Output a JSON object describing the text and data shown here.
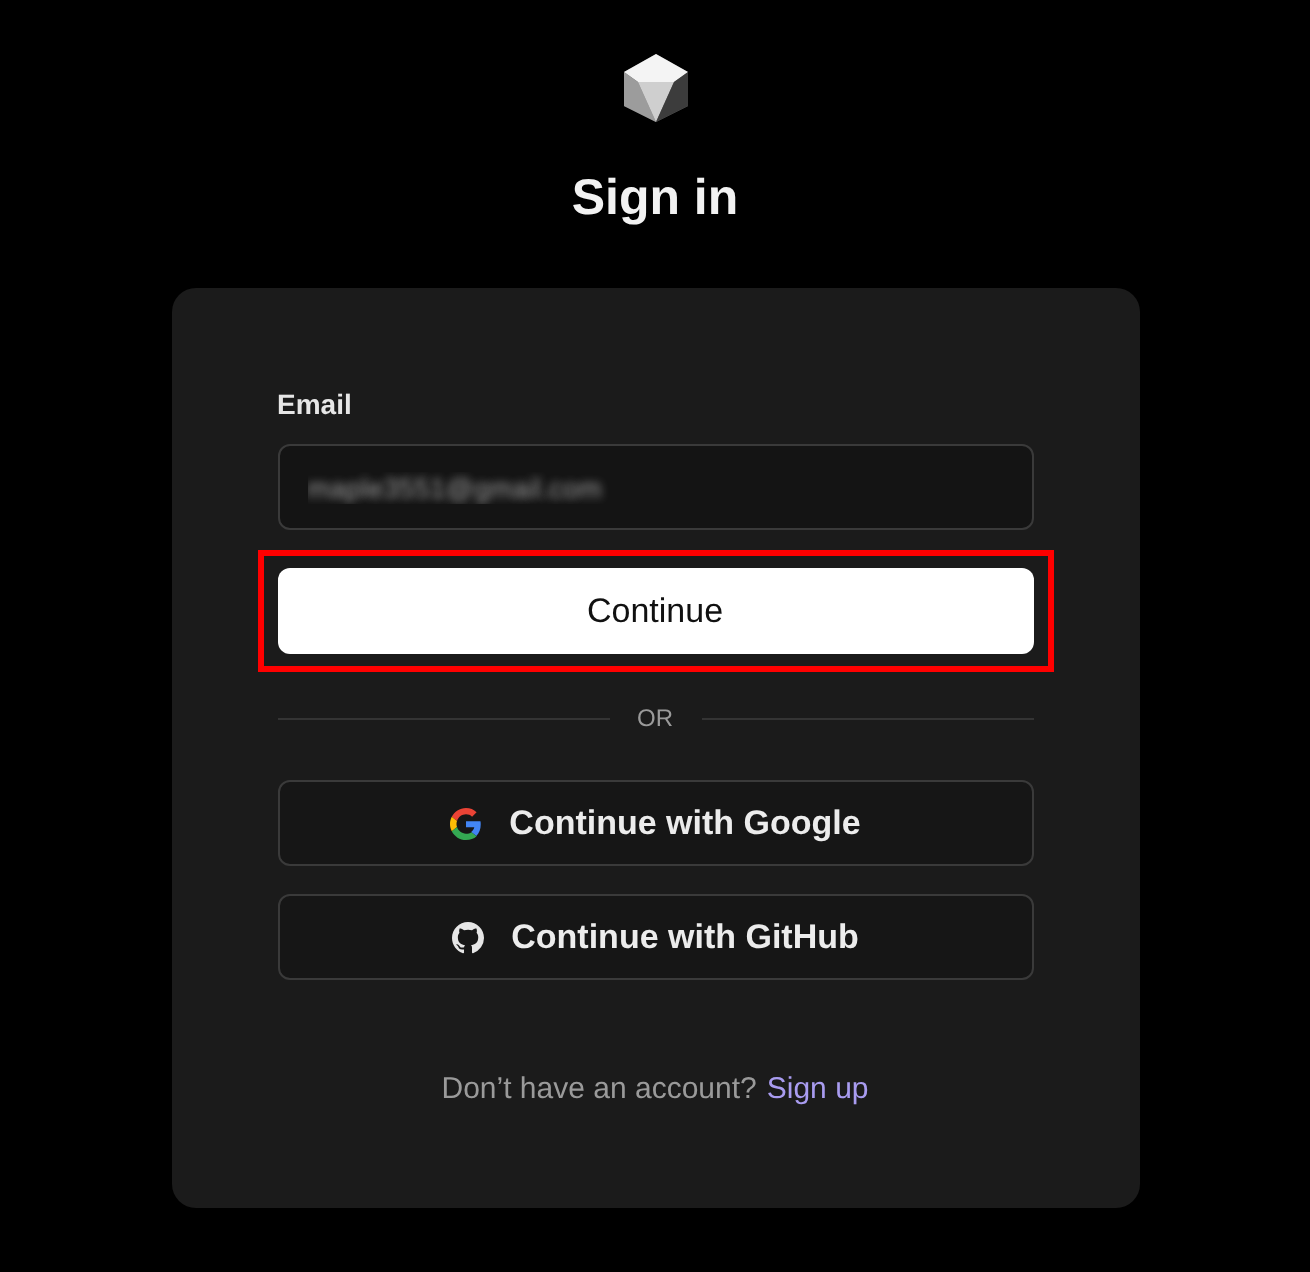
{
  "title": "Sign in",
  "email_field": {
    "label": "Email",
    "value": "maple3551@gmail.com",
    "blurred": true
  },
  "continue_button": {
    "label": "Continue",
    "highlighted": true
  },
  "divider": "OR",
  "providers": [
    {
      "kind": "google",
      "label": "Continue with Google"
    },
    {
      "kind": "github",
      "label": "Continue with GitHub"
    }
  ],
  "footer": {
    "text": "Don’t have an account?",
    "link": "Sign up"
  }
}
